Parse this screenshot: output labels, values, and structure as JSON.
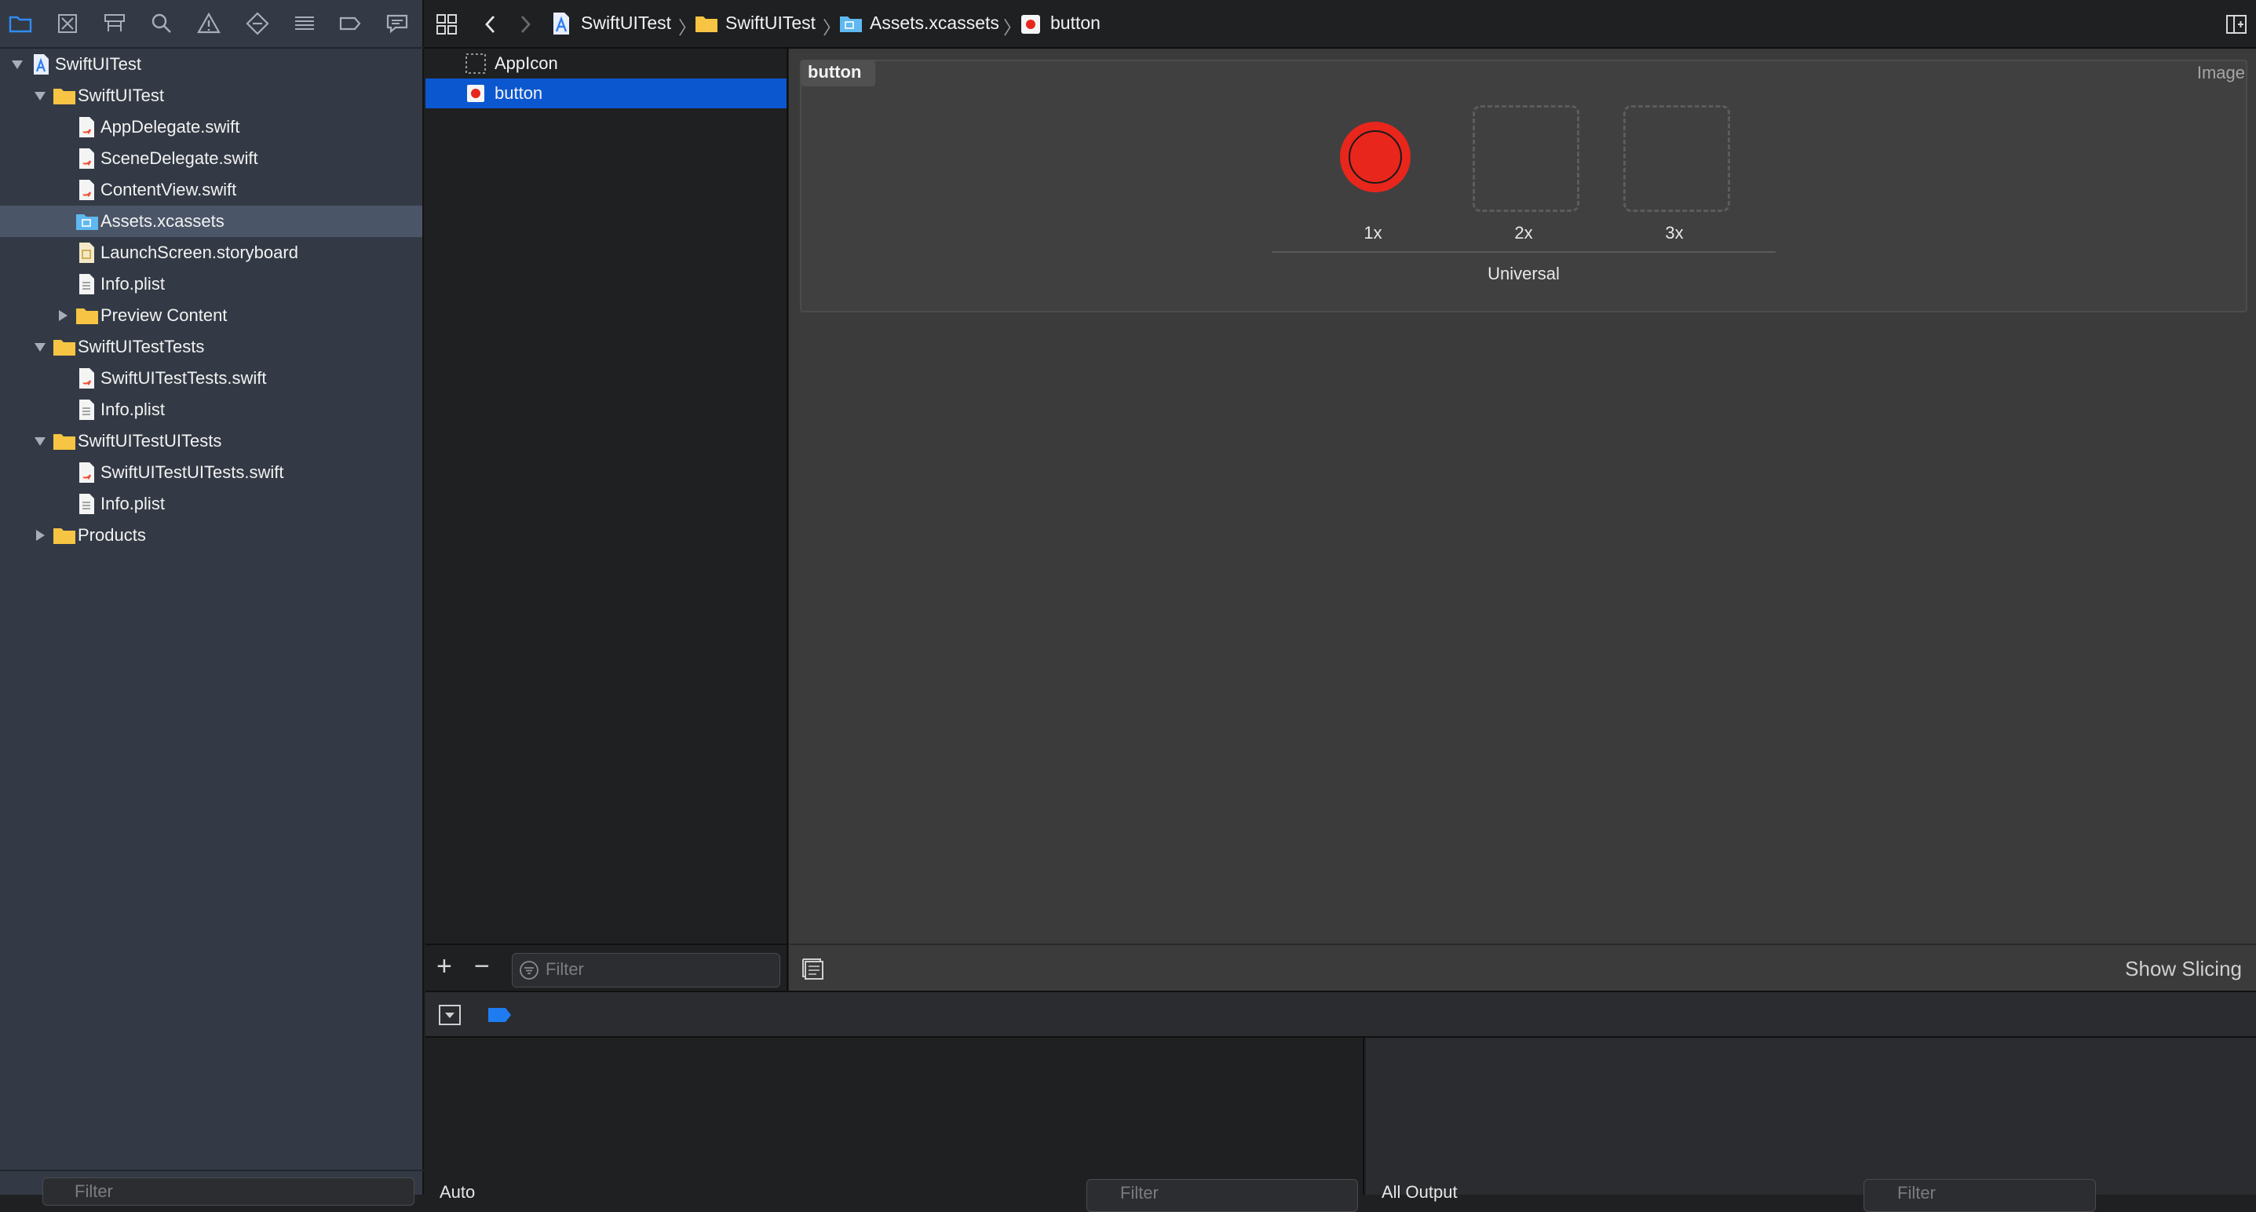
{
  "navigator": {
    "tabs": [
      "folder-icon",
      "source-control-icon",
      "symbol-icon",
      "search-icon",
      "issue-warning-icon",
      "test-diamond-icon",
      "debug-list-icon",
      "breakpoint-tag-icon",
      "report-bubble-icon"
    ],
    "tree": [
      {
        "label": "SwiftUITest",
        "type": "project",
        "expanded": true
      },
      {
        "label": "SwiftUITest",
        "type": "folder",
        "expanded": true
      },
      {
        "label": "AppDelegate.swift",
        "type": "swift"
      },
      {
        "label": "SceneDelegate.swift",
        "type": "swift"
      },
      {
        "label": "ContentView.swift",
        "type": "swift"
      },
      {
        "label": "Assets.xcassets",
        "type": "assets",
        "selected": true
      },
      {
        "label": "LaunchScreen.storyboard",
        "type": "storyboard"
      },
      {
        "label": "Info.plist",
        "type": "plist"
      },
      {
        "label": "Preview Content",
        "type": "folder",
        "expanded": false
      },
      {
        "label": "SwiftUITestTests",
        "type": "folder",
        "expanded": true
      },
      {
        "label": "SwiftUITestTests.swift",
        "type": "swift"
      },
      {
        "label": "Info.plist",
        "type": "plist"
      },
      {
        "label": "SwiftUITestUITests",
        "type": "folder",
        "expanded": true
      },
      {
        "label": "SwiftUITestUITests.swift",
        "type": "swift"
      },
      {
        "label": "Info.plist",
        "type": "plist"
      },
      {
        "label": "Products",
        "type": "folder",
        "expanded": false
      }
    ],
    "filter_placeholder": "Filter"
  },
  "jumpbar": {
    "crumbs": [
      "SwiftUITest",
      "SwiftUITest",
      "Assets.xcassets",
      "button"
    ]
  },
  "asset_list": {
    "items": [
      {
        "label": "AppIcon",
        "selected": false
      },
      {
        "label": "button",
        "selected": true
      }
    ],
    "add_label": "+",
    "remove_label": "−",
    "filter_placeholder": "Filter"
  },
  "asset_detail": {
    "set_name": "button",
    "set_type": "Image",
    "slots": [
      "1x",
      "2x",
      "3x"
    ],
    "idiom": "Universal",
    "show_slicing": "Show Slicing"
  },
  "debug": {
    "variables_scope": "Auto",
    "variables_filter": "Filter",
    "console_output": "All Output",
    "console_filter": "Filter"
  },
  "colors": {
    "accent": "#0b57d0",
    "selection_nav": "#4b5568",
    "asset_red": "#e8261c",
    "folder_yellow": "#f7c443"
  }
}
